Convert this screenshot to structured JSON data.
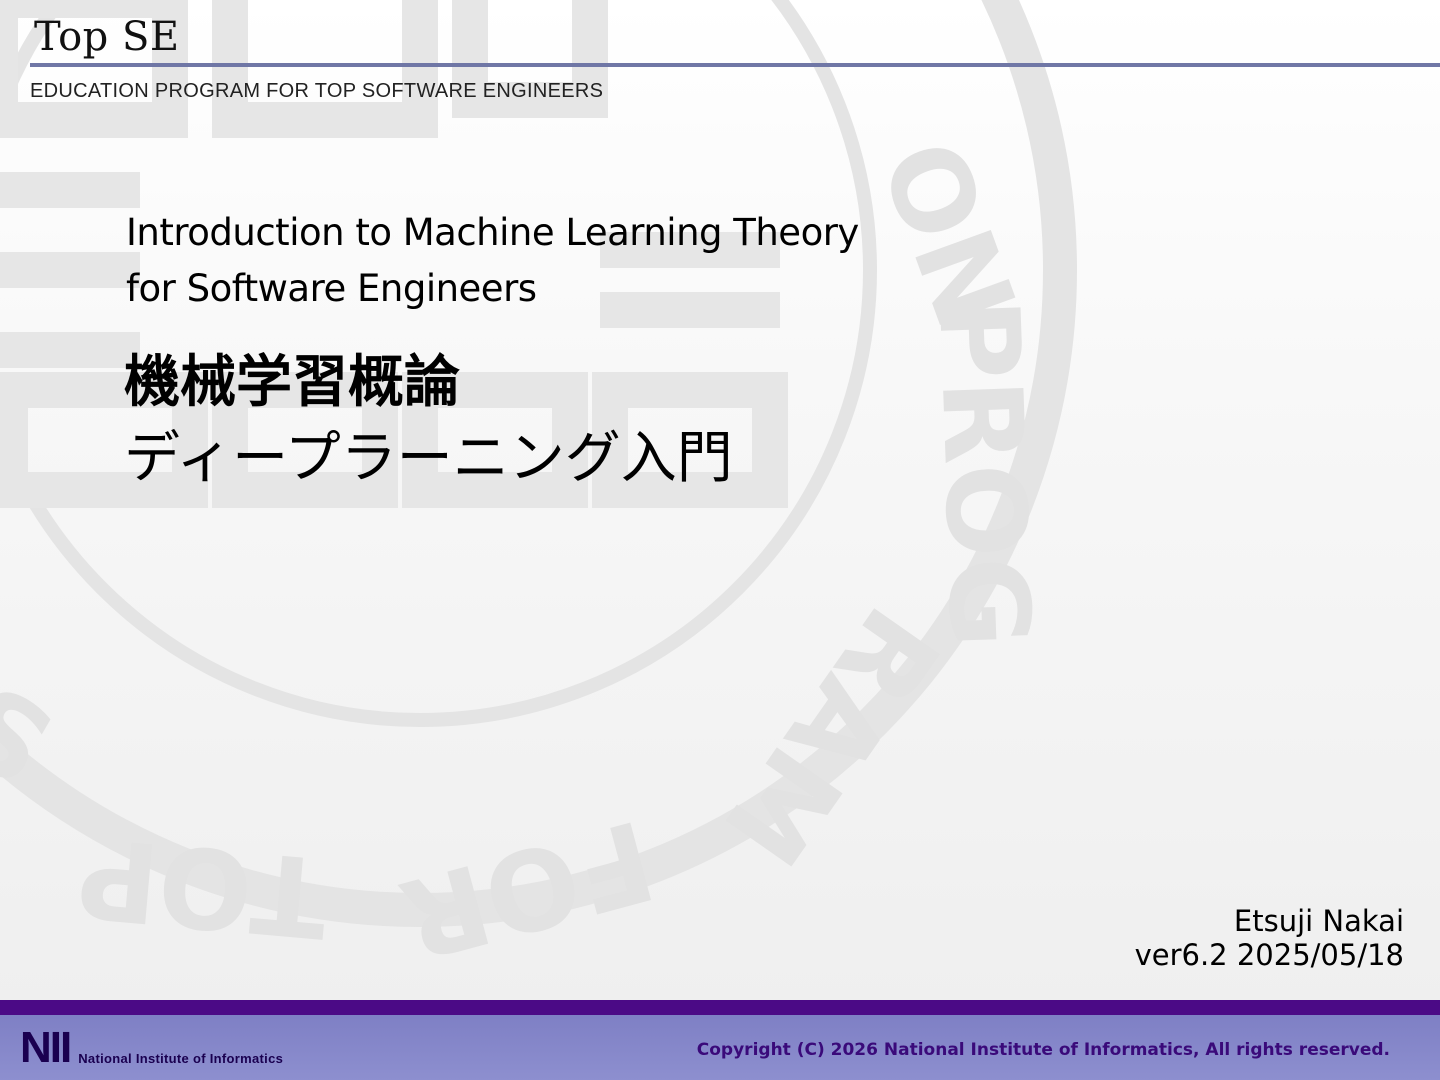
{
  "header": {
    "brand": "Top SE",
    "subtitle": "EDUCATION PROGRAM FOR TOP SOFTWARE ENGINEERS"
  },
  "title": {
    "english": [
      "Introduction to Machine Learning Theory",
      "for Software Engineers"
    ],
    "japanese": [
      "機械学習概論",
      "ディープラーニング入門"
    ]
  },
  "author": {
    "name": "Etsuji Nakai",
    "version": "ver6.2 2025/05/18"
  },
  "footer": {
    "logo_mark": "NII",
    "logo_name": "National Institute of Informatics",
    "copyright": "Copyright (C) 2026 National Institute of Informatics, All rights reserved."
  },
  "colors": {
    "accent_rule": "#7077a6",
    "footer_bar": "#4b0a86",
    "footer_bg": "#8486c9"
  }
}
